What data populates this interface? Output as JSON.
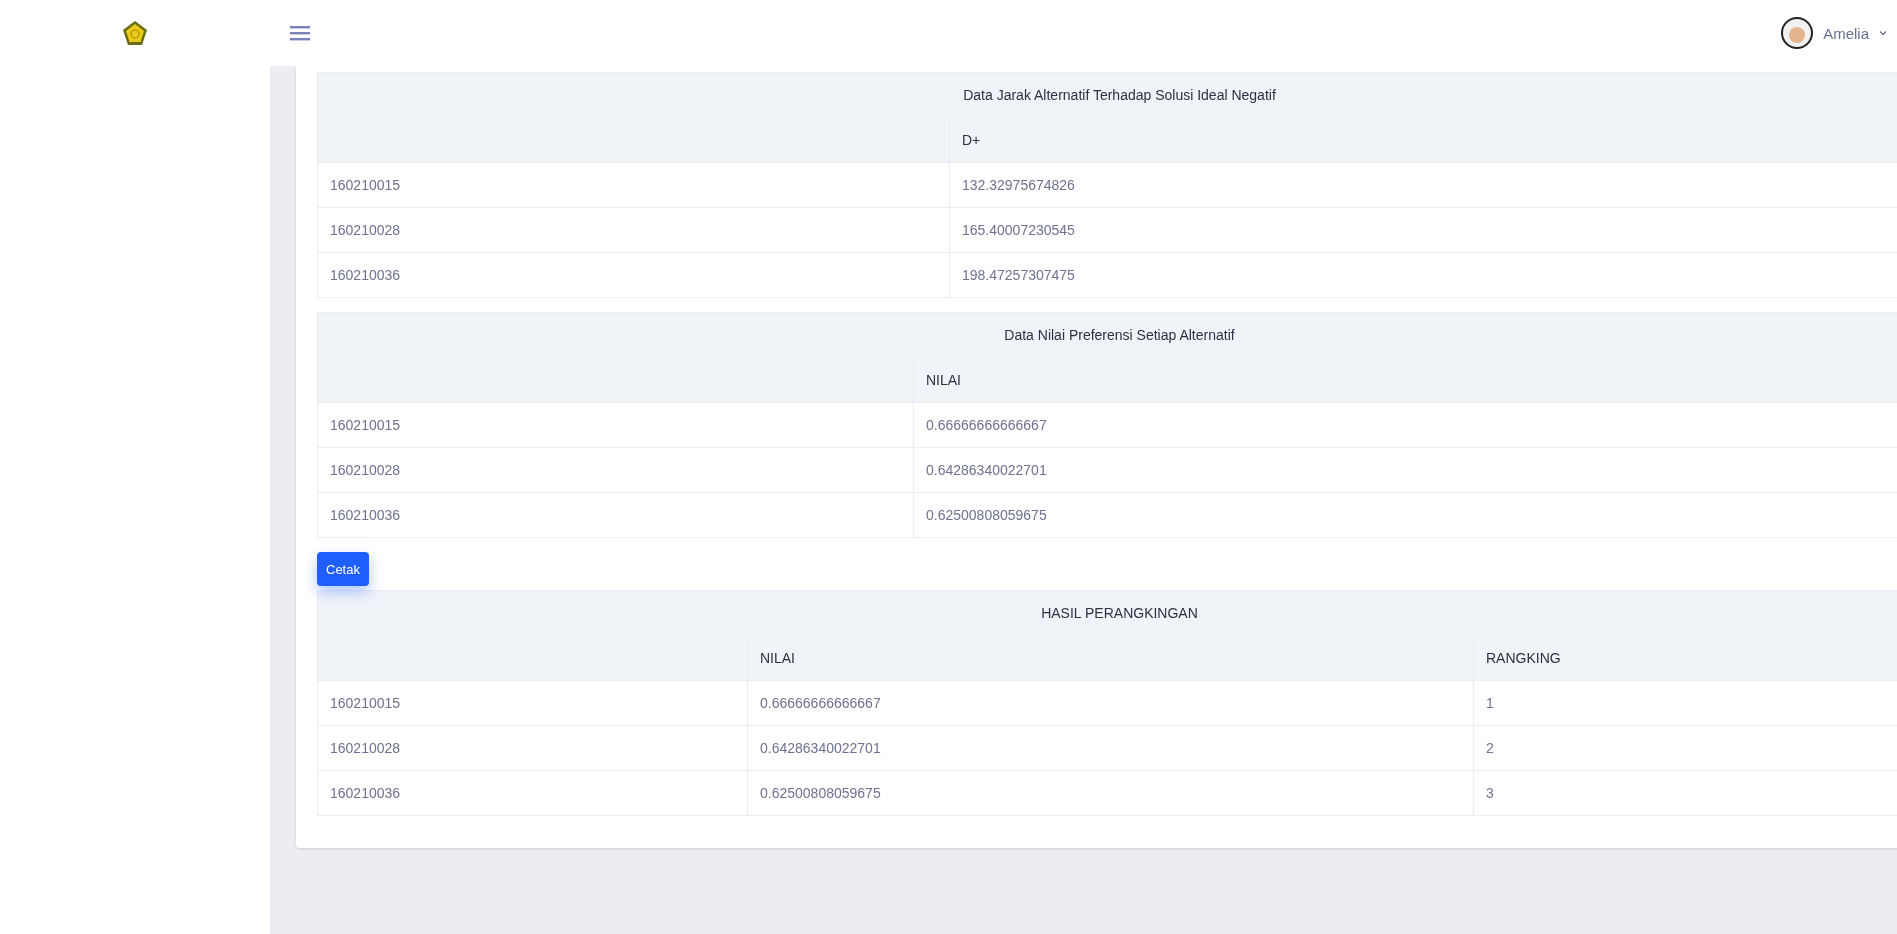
{
  "header": {
    "user_name": "Amelia"
  },
  "content": [
    {
      "kind": "table",
      "title": "Data Jarak Alternatif Terhadap Solusi Ideal Negatif",
      "columns": [
        "",
        "D+"
      ],
      "rows": [
        [
          "160210015",
          "132.32975674826"
        ],
        [
          "160210028",
          "165.40007230545"
        ],
        [
          "160210036",
          "198.47257307475"
        ]
      ]
    },
    {
      "kind": "table",
      "title": "Data Nilai Preferensi Setiap Alternatif",
      "columns": [
        "",
        "NILAI"
      ],
      "rows": [
        [
          "160210015",
          "0.66666666666667"
        ],
        [
          "160210028",
          "0.64286340022701"
        ],
        [
          "160210036",
          "0.62500808059675"
        ]
      ]
    },
    {
      "kind": "button",
      "label": "Cetak"
    },
    {
      "kind": "table",
      "title": "HASIL PERANGKINGAN",
      "columns": [
        "",
        "NILAI",
        "RANGKING"
      ],
      "rows": [
        [
          "160210015",
          "0.66666666666667",
          "1"
        ],
        [
          "160210028",
          "0.64286340022701",
          "2"
        ],
        [
          "160210036",
          "0.62500808059675",
          "3"
        ]
      ]
    }
  ]
}
